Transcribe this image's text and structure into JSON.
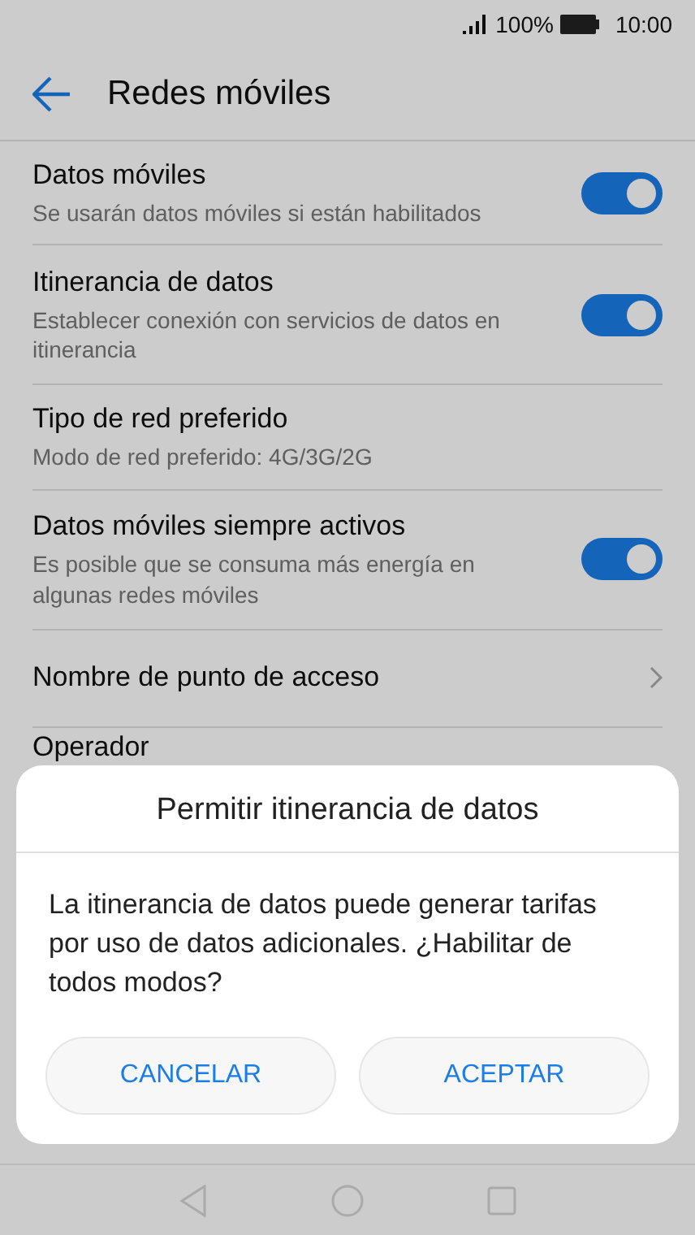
{
  "status_bar": {
    "battery": "100%",
    "time": "10:00"
  },
  "header": {
    "title": "Redes móviles"
  },
  "settings": [
    {
      "kind": "switch",
      "title": "Datos móviles",
      "subtitle": "Se usarán datos móviles si están habilitados",
      "on": true
    },
    {
      "kind": "switch",
      "title": "Itinerancia de datos",
      "subtitle": "Establecer conexión con servicios de datos en itinerancia",
      "on": true
    },
    {
      "kind": "info",
      "title": "Tipo de red preferido",
      "subtitle": "Modo de red preferido: 4G/3G/2G"
    },
    {
      "kind": "switch",
      "title": "Datos móviles siempre activos",
      "subtitle": "Es posible que se consuma más energía en algunas redes móviles",
      "on": true
    },
    {
      "kind": "link",
      "title": "Nombre de punto de acceso"
    },
    {
      "kind": "info",
      "title": "Operador"
    }
  ],
  "dialog": {
    "title": "Permitir itinerancia de datos",
    "message": "La itinerancia de datos puede generar tarifas por uso de datos adicionales. ¿Habilitar de todos modos?",
    "buttons": [
      "CANCELAR",
      "ACEPTAR"
    ]
  }
}
